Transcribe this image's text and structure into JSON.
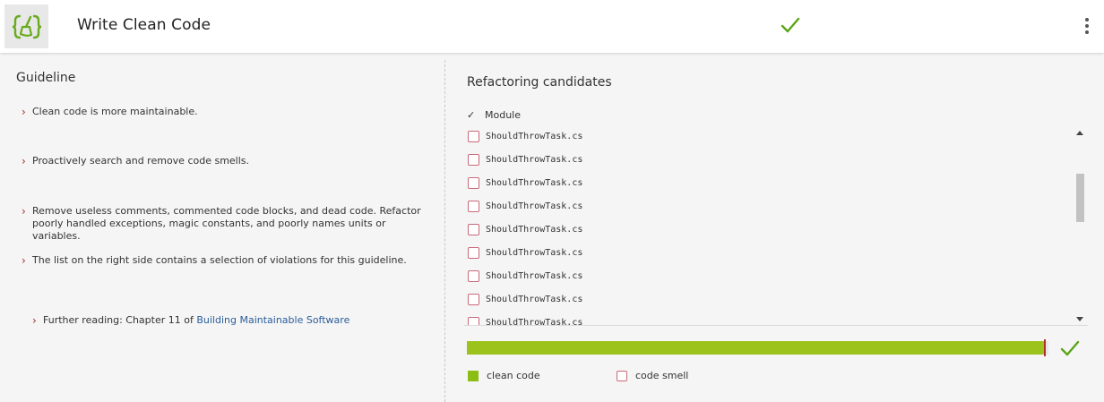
{
  "header": {
    "title": "Write Clean Code",
    "logo_icon": "curly-brace-broom-logo",
    "status_icon": "checkmark-icon",
    "menu_icon": "kebab-menu-icon"
  },
  "guideline": {
    "title": "Guideline",
    "items": [
      "Clean code is more maintainable.",
      "Proactively search and remove code smells.",
      "Remove useless comments, commented code blocks, and dead code. Refactor poorly handled exceptions, magic constants, and poorly names units or variables.",
      "The list on the right side contains a selection of violations for this guideline."
    ],
    "further_reading_prefix": "Further reading: Chapter 11 of ",
    "further_reading_link": "Building Maintainable Software"
  },
  "refactoring": {
    "title": "Refactoring candidates",
    "column_header": "Module",
    "files": [
      "ShouldThrowTask.cs",
      "ShouldThrowTask.cs",
      "ShouldThrowTask.cs",
      "ShouldThrowTask.cs",
      "ShouldThrowTask.cs",
      "ShouldThrowTask.cs",
      "ShouldThrowTask.cs",
      "ShouldThrowTask.cs",
      "ShouldThrowTask.cs"
    ],
    "progress_fraction": 0.995
  },
  "legend": {
    "clean": "clean code",
    "smell": "code smell"
  },
  "colors": {
    "accent_green": "#9bc31c",
    "smell_red": "#c9697a",
    "link_blue": "#2a5d9a"
  }
}
